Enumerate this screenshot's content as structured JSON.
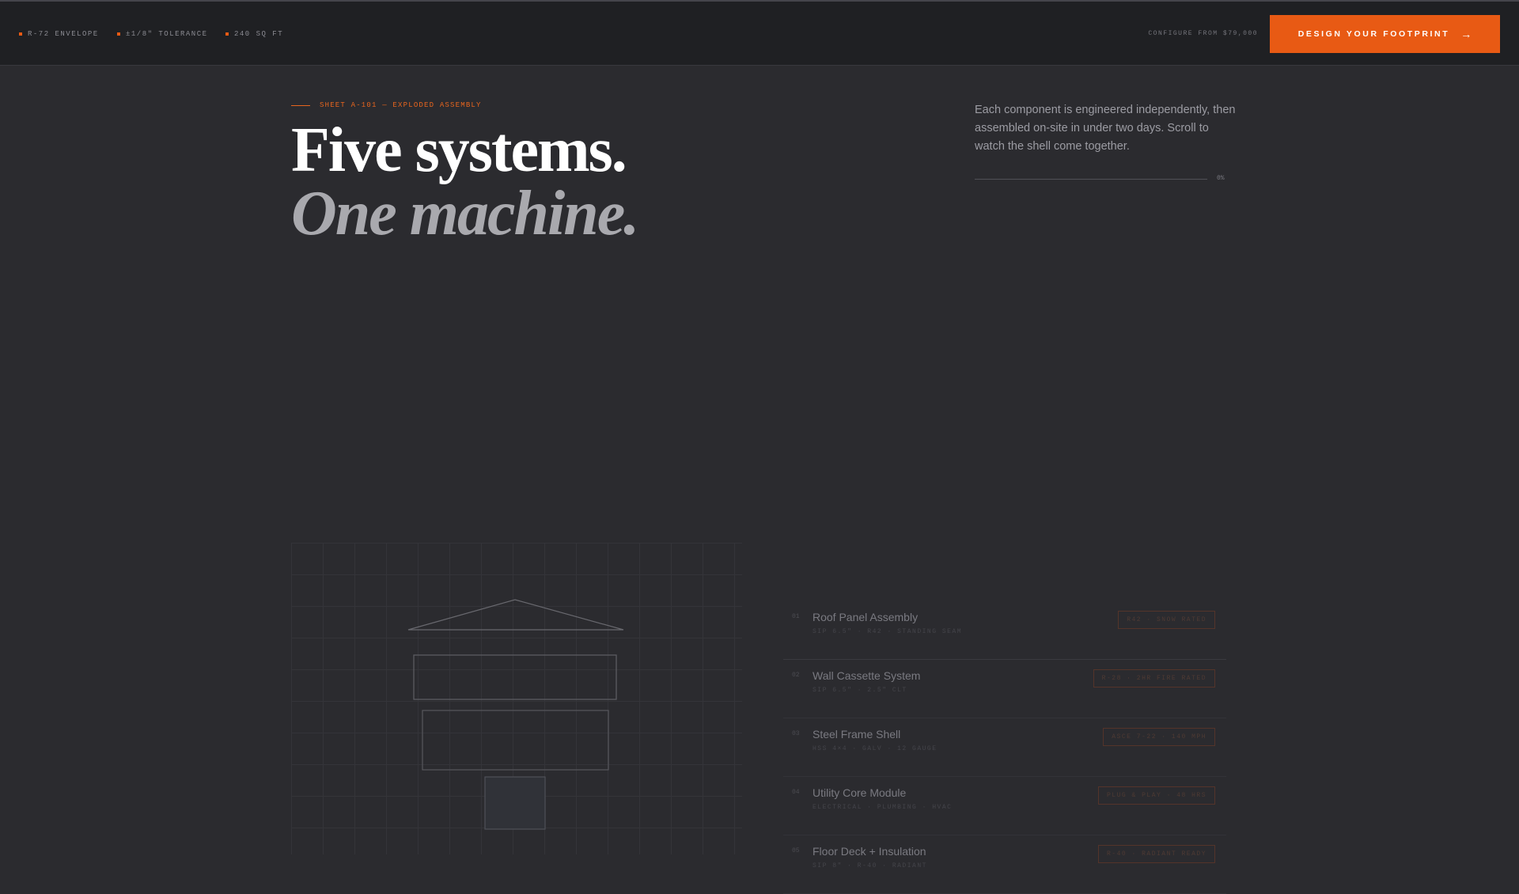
{
  "topbar": {
    "specs": [
      {
        "label": "R-72 ENVELOPE"
      },
      {
        "label": "±1/8\" TOLERANCE"
      },
      {
        "label": "240 SQ FT"
      }
    ],
    "configure_label": "CONFIGURE FROM $79,000",
    "cta_label": "DESIGN YOUR FOOTPRINT",
    "cta_icon": "arrow-right-icon"
  },
  "hero": {
    "eyebrow": "SHEET A-101 — EXPLODED ASSEMBLY",
    "headline_line1": "Five systems.",
    "headline_line2": "One machine.",
    "intro": "Each component is engineered independently, then assembled on-site in under two days. Scroll to watch the shell come together.",
    "progress_label": "0%",
    "progress_value": 0
  },
  "components": [
    {
      "num": "01",
      "name": "Roof Panel Assembly",
      "sub": "SIP 6.5\" · R42 · STANDING SEAM",
      "tag": "R42 · SNOW RATED"
    },
    {
      "num": "02",
      "name": "Wall Cassette System",
      "sub": "SIP 6.5\" · 2.5\" CLT",
      "tag": "R-28 · 2HR FIRE RATED"
    },
    {
      "num": "03",
      "name": "Steel Frame Shell",
      "sub": "HSS 4×4 · GALV · 12 GAUGE",
      "tag": "ASCE 7-22 · 140 MPH"
    },
    {
      "num": "04",
      "name": "Utility Core Module",
      "sub": "ELECTRICAL · PLUMBING · HVAC",
      "tag": "PLUG & PLAY · 48 HRS"
    },
    {
      "num": "05",
      "name": "Floor Deck + Insulation",
      "sub": "SIP 8\" · R-40 · RADIANT",
      "tag": "R-40 · RADIANT READY"
    }
  ],
  "colors": {
    "accent": "#e85a14",
    "background": "#2b2b2f",
    "topbar": "#1f2023"
  }
}
